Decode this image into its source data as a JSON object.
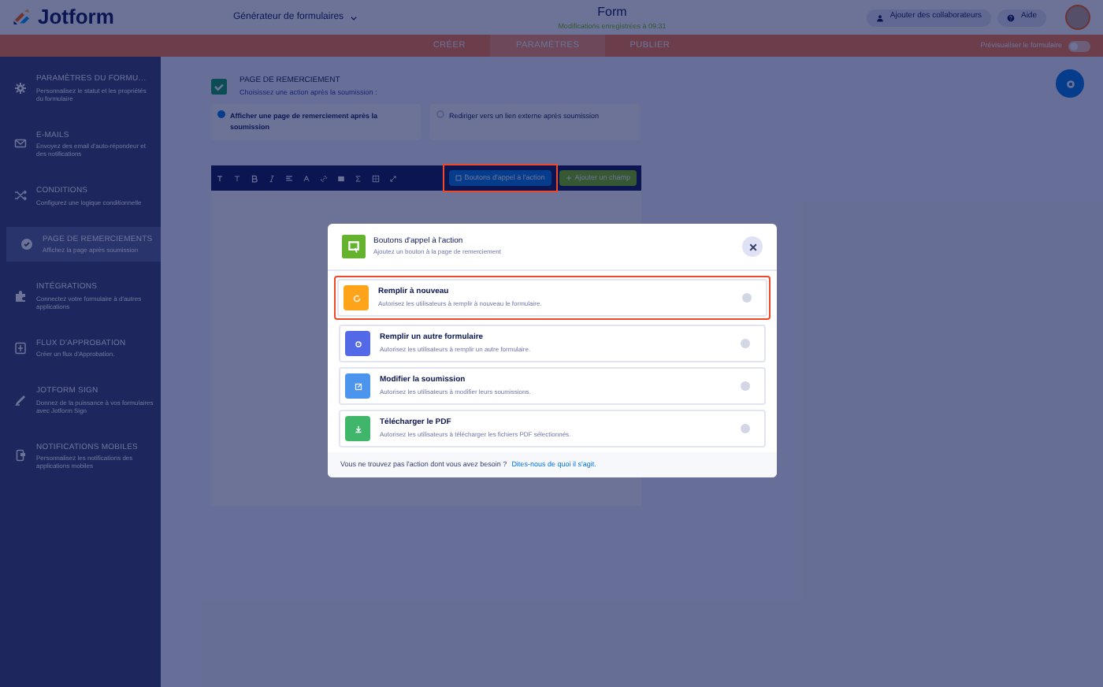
{
  "topbar": {
    "logo": "Jotform",
    "builder": "Générateur de formulaires",
    "title": "Form",
    "subtitle": "Modifications enregistrées à 09:31",
    "buttons": [
      {
        "kind": "collab",
        "label": "Ajouter des collaborateurs"
      },
      {
        "kind": "help",
        "label": "Aide"
      }
    ]
  },
  "tabs": [
    {
      "label": "CRÉER",
      "selected": false
    },
    {
      "label": "PARAMÈTRES",
      "selected": true
    },
    {
      "label": "PUBLIER",
      "selected": false
    }
  ],
  "preview": {
    "label": "Prévisualiser le formulaire",
    "on": false
  },
  "sidebar": {
    "items": [
      {
        "kind": "gear",
        "title": "PARAMÈTRES DU FORMU…",
        "description": "Personnalisez le statut et les propriétés du formulaire",
        "selected": false
      },
      {
        "kind": "mail",
        "title": "E-MAILS",
        "description": "Envoyez des email d'auto-répondeur et des notifications",
        "selected": false
      },
      {
        "kind": "shuffle",
        "title": "CONDITIONS",
        "description": "Configurez une logique conditionnelle",
        "selected": false
      },
      {
        "kind": "check",
        "title": "PAGE DE REMERCIEMENTS",
        "description": "Affichez la page après soumission",
        "selected": true
      },
      {
        "kind": "puzzle",
        "title": "INTÉGRATIONS",
        "description": "Connectez votre formulaire à d'autres applications",
        "selected": false
      },
      {
        "kind": "flow",
        "title": "FLUX D'APPROBATION",
        "description": "Créer un flux d'Approbation.",
        "selected": false
      },
      {
        "kind": "pen",
        "title": "JOTFORM SIGN",
        "description": "Donnez de la puissance à vos formulaires avec Jotform Sign",
        "selected": false
      },
      {
        "kind": "phone",
        "title": "NOTIFICATIONS MOBILES",
        "description": "Personnalisez les notifications des applications mobiles",
        "selected": false
      }
    ]
  },
  "section": {
    "title": "PAGE DE REMERCIEMENT",
    "subtitle": "Choisissez une action après la soumission :",
    "options": [
      {
        "label": "Afficher une page de remerciement après la soumission",
        "selected": true
      },
      {
        "label": "Rediriger vers un lien externe après soumission",
        "selected": false
      }
    ]
  },
  "toolbar": {
    "buttons": [
      {
        "kind": "cta",
        "label": "Boutons d'appel à l'action",
        "highlighted": true
      },
      {
        "kind": "field",
        "label": "Ajouter un champ",
        "highlighted": false
      }
    ]
  },
  "modal": {
    "title": "Boutons d'appel à l'action",
    "subtitle": "Ajoutez un bouton à la page de remerciement",
    "options": [
      {
        "kind": "refill",
        "title": "Remplir à nouveau",
        "description": "Autorisez les utilisateurs à remplir à nouveau le formulaire.",
        "color": "#ffa31a",
        "selected": false,
        "highlighted": true
      },
      {
        "kind": "another",
        "title": "Remplir un autre formulaire",
        "description": "Autorisez les utilisateurs à remplir un autre formulaire.",
        "color": "#5369e8",
        "selected": false,
        "highlighted": false
      },
      {
        "kind": "edit",
        "title": "Modifier la soumission",
        "description": "Autorisez les utilisateurs à modifier leurs soumissions.",
        "color": "#4c95ee",
        "selected": false,
        "highlighted": false
      },
      {
        "kind": "pdf",
        "title": "Télécharger le PDF",
        "description": "Autorisez les utilisateurs à télécharger les fichiers PDF sélectionnés.",
        "color": "#40b66b",
        "selected": false,
        "highlighted": false
      }
    ],
    "footer": {
      "text": "Vous ne trouvez pas l'action dont vous avez besoin ?",
      "link": "Dites-nous de quoi il s'agit."
    }
  }
}
